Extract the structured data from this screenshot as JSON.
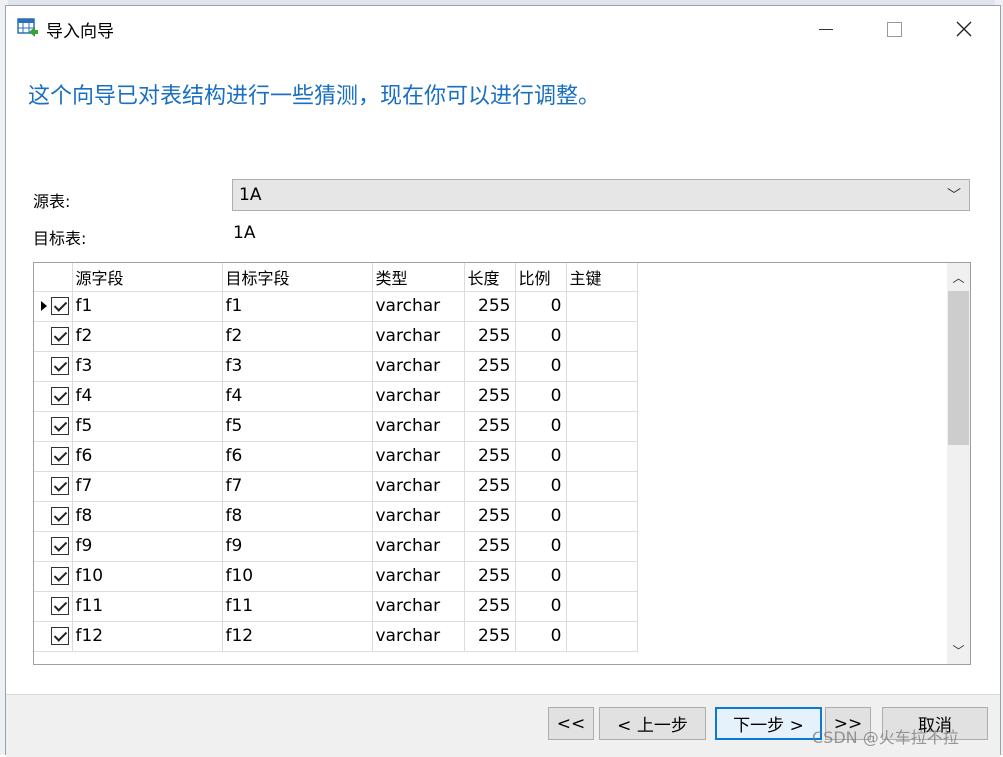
{
  "window": {
    "title": "导入向导",
    "icon": "table-import-icon"
  },
  "heading": "这个向导已对表结构进行一些猜测，现在你可以进行调整。",
  "source_label": "源表:",
  "source_value": "1A",
  "target_label": "目标表:",
  "target_value": "1A",
  "grid": {
    "headers": {
      "source": "源字段",
      "target": "目标字段",
      "type": "类型",
      "length": "长度",
      "scale": "比例",
      "key": "主键"
    },
    "rows": [
      {
        "source": "f1",
        "target": "f1",
        "type": "varchar",
        "length": "255",
        "scale": "0",
        "key": ""
      },
      {
        "source": "f2",
        "target": "f2",
        "type": "varchar",
        "length": "255",
        "scale": "0",
        "key": ""
      },
      {
        "source": "f3",
        "target": "f3",
        "type": "varchar",
        "length": "255",
        "scale": "0",
        "key": ""
      },
      {
        "source": "f4",
        "target": "f4",
        "type": "varchar",
        "length": "255",
        "scale": "0",
        "key": ""
      },
      {
        "source": "f5",
        "target": "f5",
        "type": "varchar",
        "length": "255",
        "scale": "0",
        "key": ""
      },
      {
        "source": "f6",
        "target": "f6",
        "type": "varchar",
        "length": "255",
        "scale": "0",
        "key": ""
      },
      {
        "source": "f7",
        "target": "f7",
        "type": "varchar",
        "length": "255",
        "scale": "0",
        "key": ""
      },
      {
        "source": "f8",
        "target": "f8",
        "type": "varchar",
        "length": "255",
        "scale": "0",
        "key": ""
      },
      {
        "source": "f9",
        "target": "f9",
        "type": "varchar",
        "length": "255",
        "scale": "0",
        "key": ""
      },
      {
        "source": "f10",
        "target": "f10",
        "type": "varchar",
        "length": "255",
        "scale": "0",
        "key": ""
      },
      {
        "source": "f11",
        "target": "f11",
        "type": "varchar",
        "length": "255",
        "scale": "0",
        "key": ""
      },
      {
        "source": "f12",
        "target": "f12",
        "type": "varchar",
        "length": "255",
        "scale": "0",
        "key": ""
      }
    ]
  },
  "buttons": {
    "first": "<<",
    "prev": "< 上一步",
    "next": "下一步 >",
    "last": ">>",
    "cancel": "取消"
  },
  "watermark": "CSDN @火车拉不拉",
  "colors": {
    "heading": "#1a6fc0",
    "default_button_border": "#0a78d7"
  }
}
